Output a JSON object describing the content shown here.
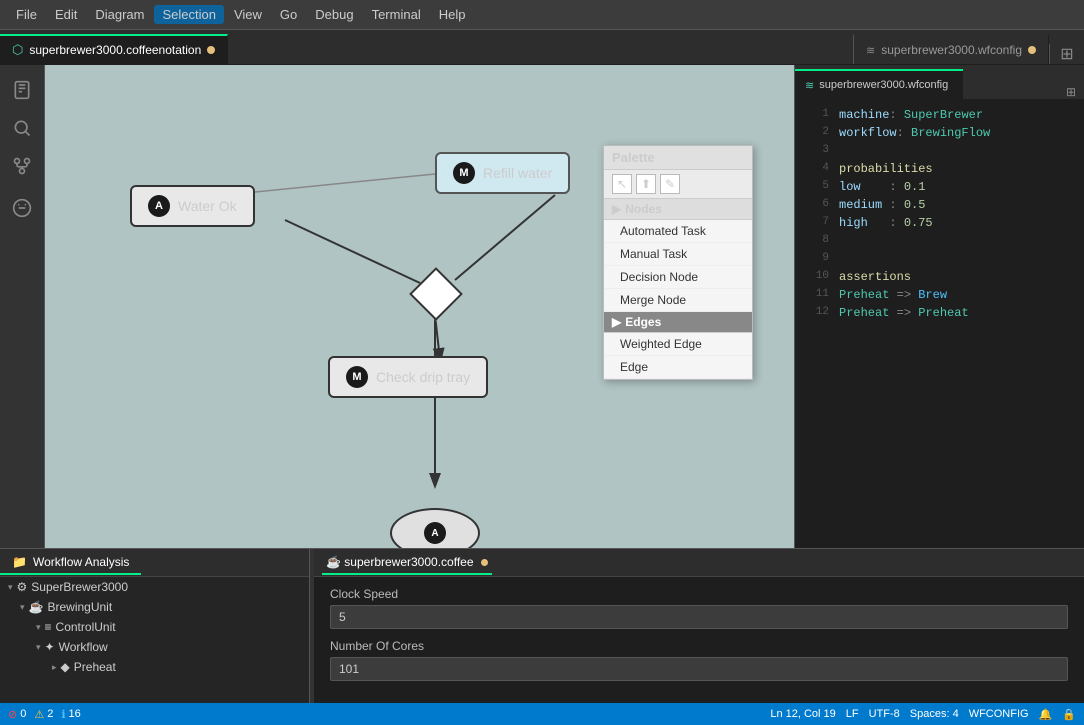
{
  "menubar": {
    "items": [
      "File",
      "Edit",
      "Diagram",
      "Selection",
      "View",
      "Go",
      "Debug",
      "Terminal",
      "Help"
    ],
    "active": "Selection"
  },
  "tabs": {
    "left": {
      "icon": "⬡",
      "filename": "superbrewer3000.coffeenotation",
      "dot": true
    },
    "right": {
      "icon": "≋",
      "filename": "superbrewer3000.wfconfig",
      "dot": true
    }
  },
  "sidebar_icons": [
    "📄",
    "🔍",
    "✂",
    "🚫"
  ],
  "diagram": {
    "nodes": {
      "water_ok": {
        "label": "A",
        "text": "Water Ok"
      },
      "refill_water": {
        "label": "M",
        "text": "Refill water"
      },
      "check_drip": {
        "label": "M",
        "text": "Check drip tray"
      }
    }
  },
  "palette": {
    "title": "Palette",
    "tools": [
      "↖",
      "⬆",
      "✎"
    ],
    "nodes_section": "Nodes",
    "node_items": [
      "Automated Task",
      "Manual Task",
      "Decision Node",
      "Merge Node"
    ],
    "edges_section": "Edges",
    "edge_items": [
      "Weighted Edge",
      "Edge"
    ]
  },
  "code": {
    "filename": "superbrewer3000.wfconfig",
    "lines": [
      {
        "num": 1,
        "parts": [
          {
            "t": "key",
            "v": "machine"
          },
          {
            "t": "op",
            "v": ": "
          },
          {
            "t": "green",
            "v": "SuperBrewer"
          }
        ]
      },
      {
        "num": 2,
        "parts": [
          {
            "t": "key",
            "v": "workflow"
          },
          {
            "t": "op",
            "v": ": "
          },
          {
            "t": "green",
            "v": "BrewingFlow"
          }
        ]
      },
      {
        "num": 3,
        "parts": []
      },
      {
        "num": 4,
        "parts": [
          {
            "t": "section",
            "v": "probabilities"
          }
        ]
      },
      {
        "num": 5,
        "parts": [
          {
            "t": "key",
            "v": "low"
          },
          {
            "t": "op",
            "v": "    : "
          },
          {
            "t": "num",
            "v": "0.1"
          }
        ]
      },
      {
        "num": 6,
        "parts": [
          {
            "t": "key",
            "v": "medium"
          },
          {
            "t": "op",
            "v": " : "
          },
          {
            "t": "num",
            "v": "0.5"
          }
        ]
      },
      {
        "num": 7,
        "parts": [
          {
            "t": "key",
            "v": "high"
          },
          {
            "t": "op",
            "v": "   : "
          },
          {
            "t": "num",
            "v": "0.75"
          }
        ]
      },
      {
        "num": 8,
        "parts": []
      },
      {
        "num": 9,
        "parts": []
      },
      {
        "num": 10,
        "parts": [
          {
            "t": "section",
            "v": "assertions"
          }
        ]
      },
      {
        "num": 11,
        "parts": [
          {
            "t": "green",
            "v": "Preheat"
          },
          {
            "t": "op",
            "v": " => "
          },
          {
            "t": "blue",
            "v": "Brew"
          }
        ]
      },
      {
        "num": 12,
        "parts": [
          {
            "t": "green",
            "v": "Preheat"
          },
          {
            "t": "op",
            "v": " => "
          },
          {
            "t": "green",
            "v": "Preheat"
          }
        ]
      }
    ]
  },
  "bottom": {
    "left_tab": "Workflow Analysis",
    "right_tab": "superbrewer3000.coffee",
    "tree": [
      {
        "indent": 0,
        "icon": "▾",
        "extra": "⚙",
        "label": "SuperBrewer3000"
      },
      {
        "indent": 1,
        "icon": "▾",
        "extra": "☕",
        "label": "BrewingUnit"
      },
      {
        "indent": 2,
        "icon": "▾",
        "extra": "≡",
        "label": "ControlUnit"
      },
      {
        "indent": 2,
        "icon": "▾",
        "extra": "✦",
        "label": "Workflow"
      },
      {
        "indent": 3,
        "icon": "▸",
        "extra": "◆",
        "label": "Preheat"
      }
    ],
    "props": {
      "clock_speed_label": "Clock Speed",
      "clock_speed_value": "5",
      "num_cores_label": "Number Of Cores",
      "num_cores_value": "101"
    }
  },
  "statusbar": {
    "errors": "0",
    "warnings": "2",
    "info": "16",
    "position": "Ln 12, Col 19",
    "encoding": "LF",
    "charset": "UTF-8",
    "spaces": "Spaces: 4",
    "mode": "WFCONFIG",
    "bell_icon": "🔔",
    "lock_icon": "🔒"
  }
}
